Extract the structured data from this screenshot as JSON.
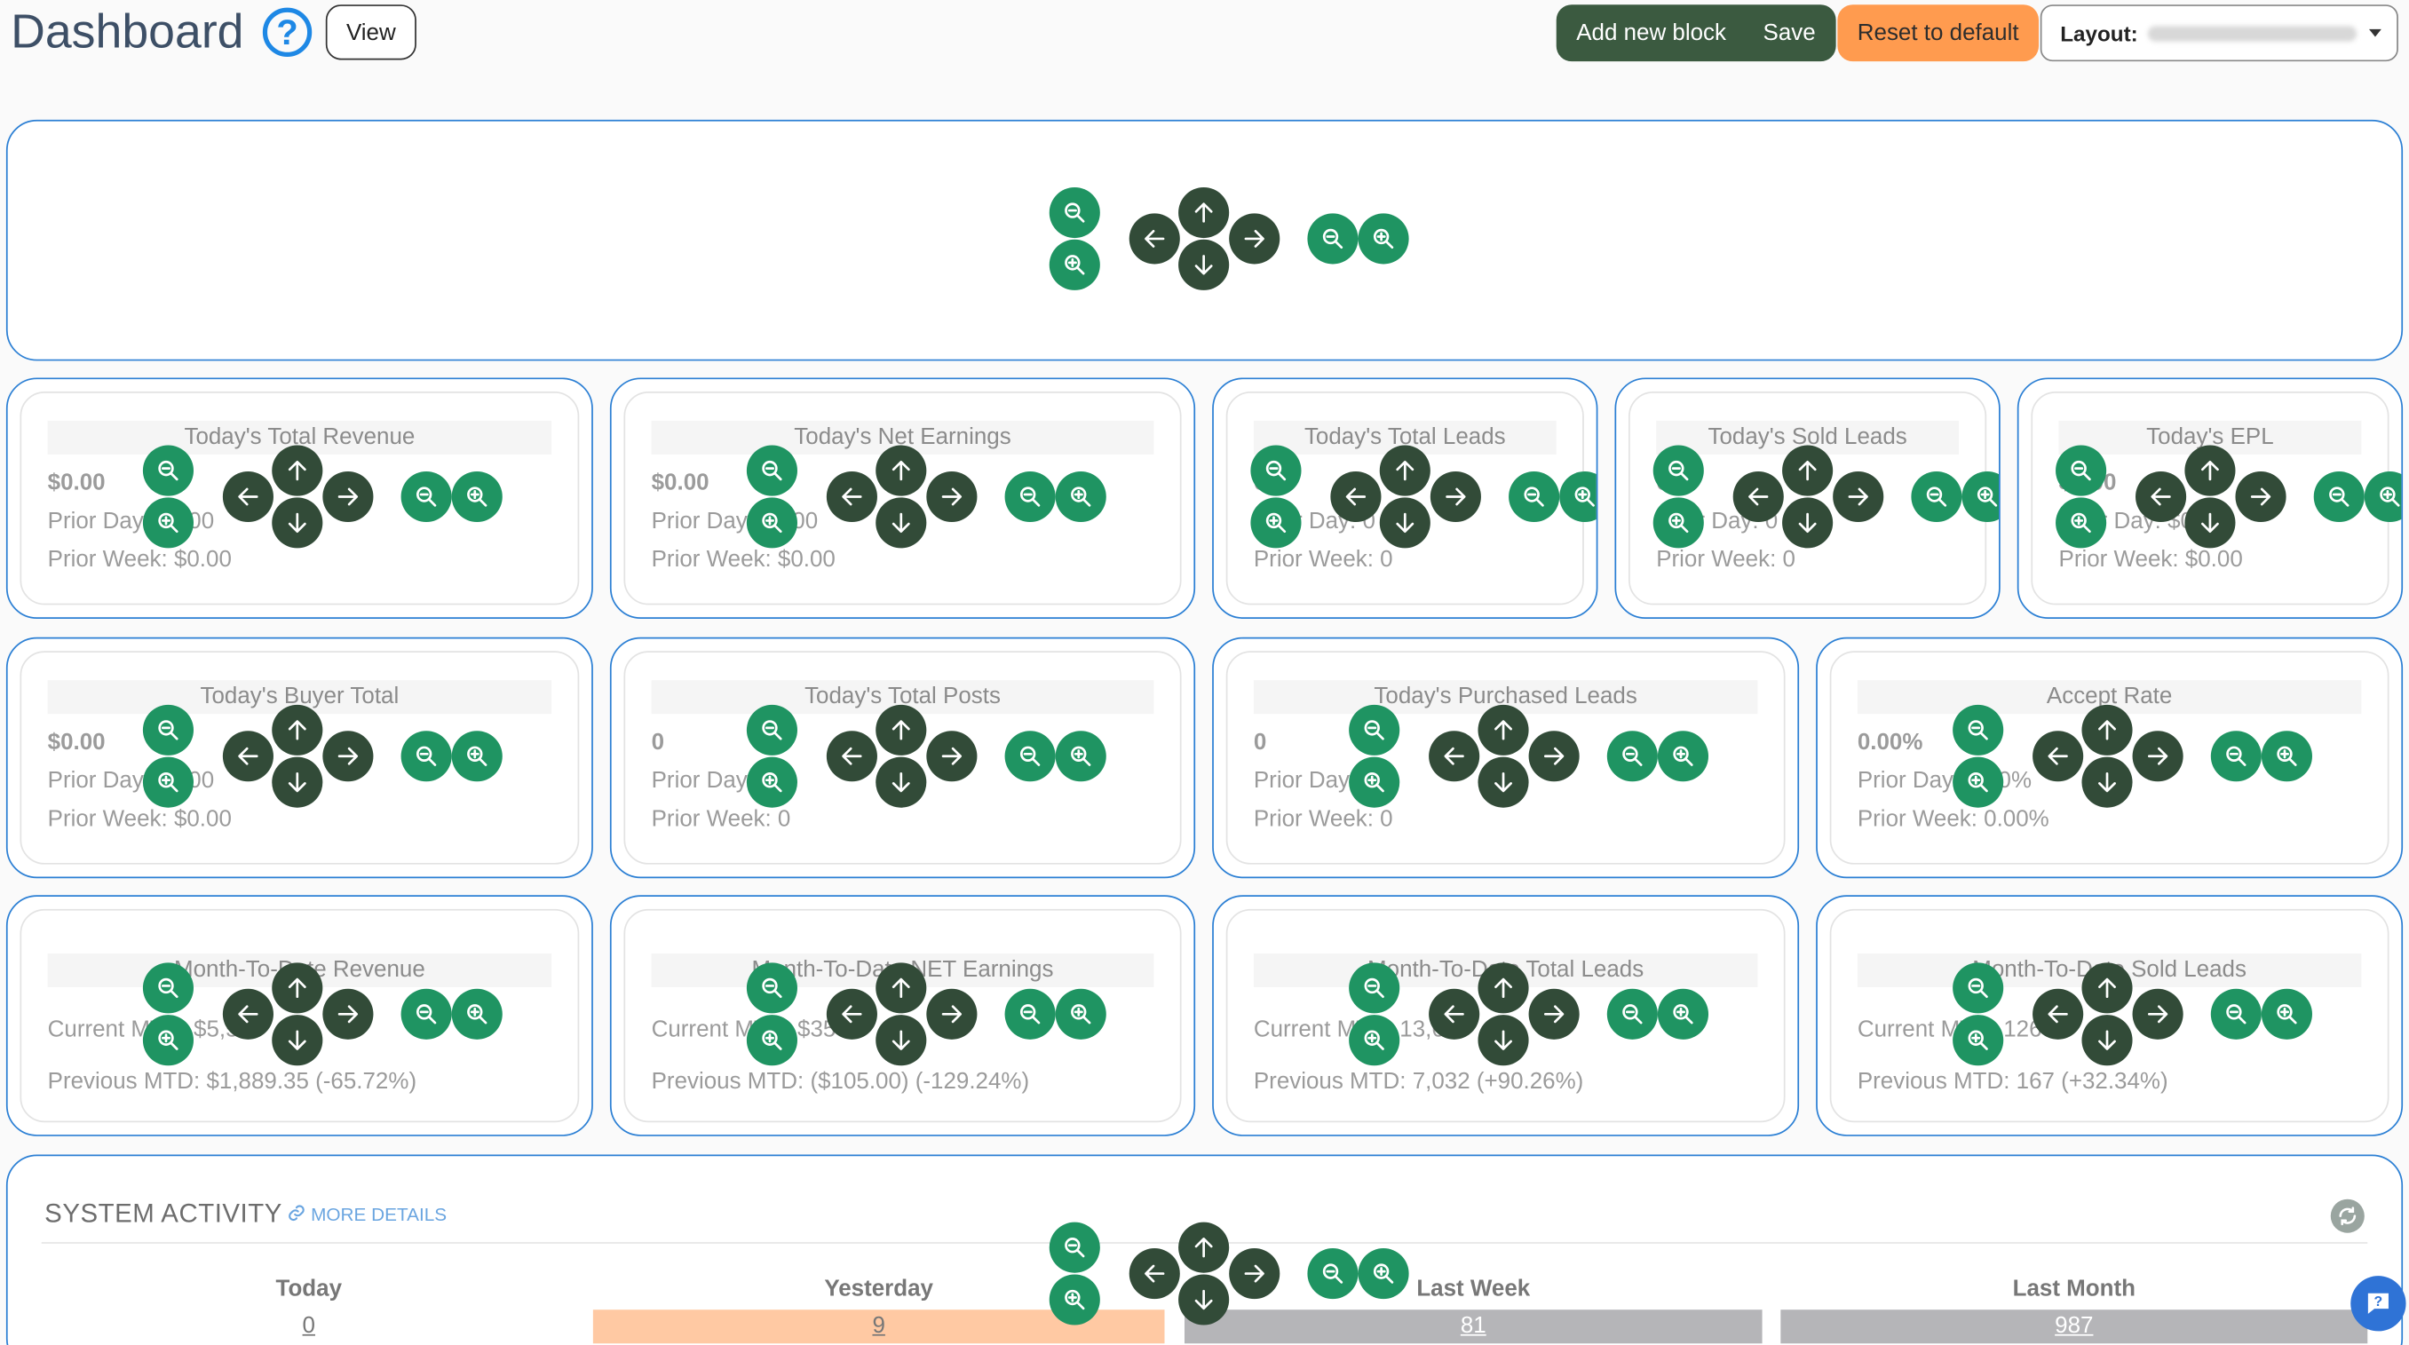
{
  "header": {
    "title": "Dashboard",
    "help": "?",
    "view_label": "View",
    "add_block_label": "Add new block",
    "save_label": "Save",
    "reset_label": "Reset to default",
    "layout_label": "Layout:"
  },
  "icons": {
    "zoom_out": "zoom-out-icon",
    "zoom_in": "zoom-in-icon",
    "arrow_left": "arrow-left-icon",
    "arrow_up": "arrow-up-icon",
    "arrow_right": "arrow-right-icon",
    "arrow_down": "arrow-down-icon",
    "refresh": "refresh-icon",
    "help_chat": "help-chat-icon",
    "link": "link-icon"
  },
  "colors": {
    "accent_blue": "#2b7fd4",
    "zoom_green": "#1f9462",
    "dark_green": "#324b38",
    "reset_orange": "#ff9b4f",
    "yesterday_bar": "#ffc9a3",
    "week_bar": "#b5b5b8"
  },
  "cards": {
    "row1": [
      {
        "title": "Today's Total Revenue",
        "value": "$0.00",
        "line1": "Prior Day: $0.00",
        "line2": "Prior Week: $0.00"
      },
      {
        "title": "Today's Net Earnings",
        "value": "$0.00",
        "line1": "Prior Day: $0.00",
        "line2": "Prior Week: $0.00"
      },
      {
        "title": "Today's Total Leads",
        "value": "0",
        "line1": "Prior Day: 0",
        "line2": "Prior Week: 0"
      },
      {
        "title": "Today's Sold Leads",
        "value": "0",
        "line1": "Prior Day: 0",
        "line2": "Prior Week: 0"
      },
      {
        "title": "Today's EPL",
        "value": "$0.00",
        "line1": "Prior Day: $0.00",
        "line2": "Prior Week: $0.00"
      }
    ],
    "row2": [
      {
        "title": "Today's Buyer Total",
        "value": "$0.00",
        "line1": "Prior Day: $0.00",
        "line2": "Prior Week: $0.00"
      },
      {
        "title": "Today's Total Posts",
        "value": "0",
        "line1": "Prior Day: 0",
        "line2": "Prior Week: 0"
      },
      {
        "title": "Today's Purchased Leads",
        "value": "0",
        "line1": "Prior Day: 0",
        "line2": "Prior Week: 0"
      },
      {
        "title": "Accept Rate",
        "value": "0.00%",
        "line1": "Prior Day: 0.00%",
        "line2": "Prior Week: 0.00%"
      }
    ],
    "row3": [
      {
        "title": "Month-To-Date Revenue",
        "line1": "Current MTD: $5,5",
        "line2": "Previous MTD: $1,889.35 (-65.72%)"
      },
      {
        "title": "Month-To-Date NET Earnings",
        "line1": "Current MTD: $35",
        "line2": "Previous MTD: ($105.00) (-129.24%)"
      },
      {
        "title": "Month-To-Date Total Leads",
        "line1": "Current MTD: 13,69",
        "line2": "Previous MTD: 7,032 (+90.26%)"
      },
      {
        "title": "Month-To-Date Sold Leads",
        "line1": "Current MTD: 126",
        "line2": "Previous MTD: 167 (+32.34%)"
      }
    ]
  },
  "system_activity": {
    "title": "SYSTEM ACTIVITY",
    "more_details": "MORE DETAILS",
    "columns": [
      {
        "label": "Today",
        "value": "0"
      },
      {
        "label": "Yesterday",
        "value": "9"
      },
      {
        "label": "Last Week",
        "value": "81"
      },
      {
        "label": "Last Month",
        "value": "987"
      }
    ]
  }
}
